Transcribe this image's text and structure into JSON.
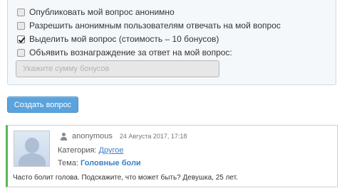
{
  "options": [
    {
      "label": "Опубликовать мой вопрос анонимно",
      "checked": false
    },
    {
      "label": "Разрешить анонимным пользователям отвечать на мой вопрос",
      "checked": false
    },
    {
      "label": "Выделить мой вопрос (стоимость – 10 бонусов)",
      "checked": true
    },
    {
      "label": "Объявить вознаграждение за ответ на мой вопрос:",
      "checked": false
    }
  ],
  "bonus_input": {
    "placeholder": "Укажите сумму бонусов",
    "value": ""
  },
  "create_button": {
    "label": "Создать вопрос",
    "color": "#5aa3dc"
  },
  "question": {
    "username": "anonymous",
    "date": "24 Августа 2017, 17:18",
    "category_label": "Категория:",
    "category_value": "Другое",
    "topic_label": "Тема:",
    "topic_value": "Головные боли",
    "text": "Часто болит голова. Подскажите, что может быть? Девушка, 25 лет.",
    "accent_color": "#58b85a"
  }
}
